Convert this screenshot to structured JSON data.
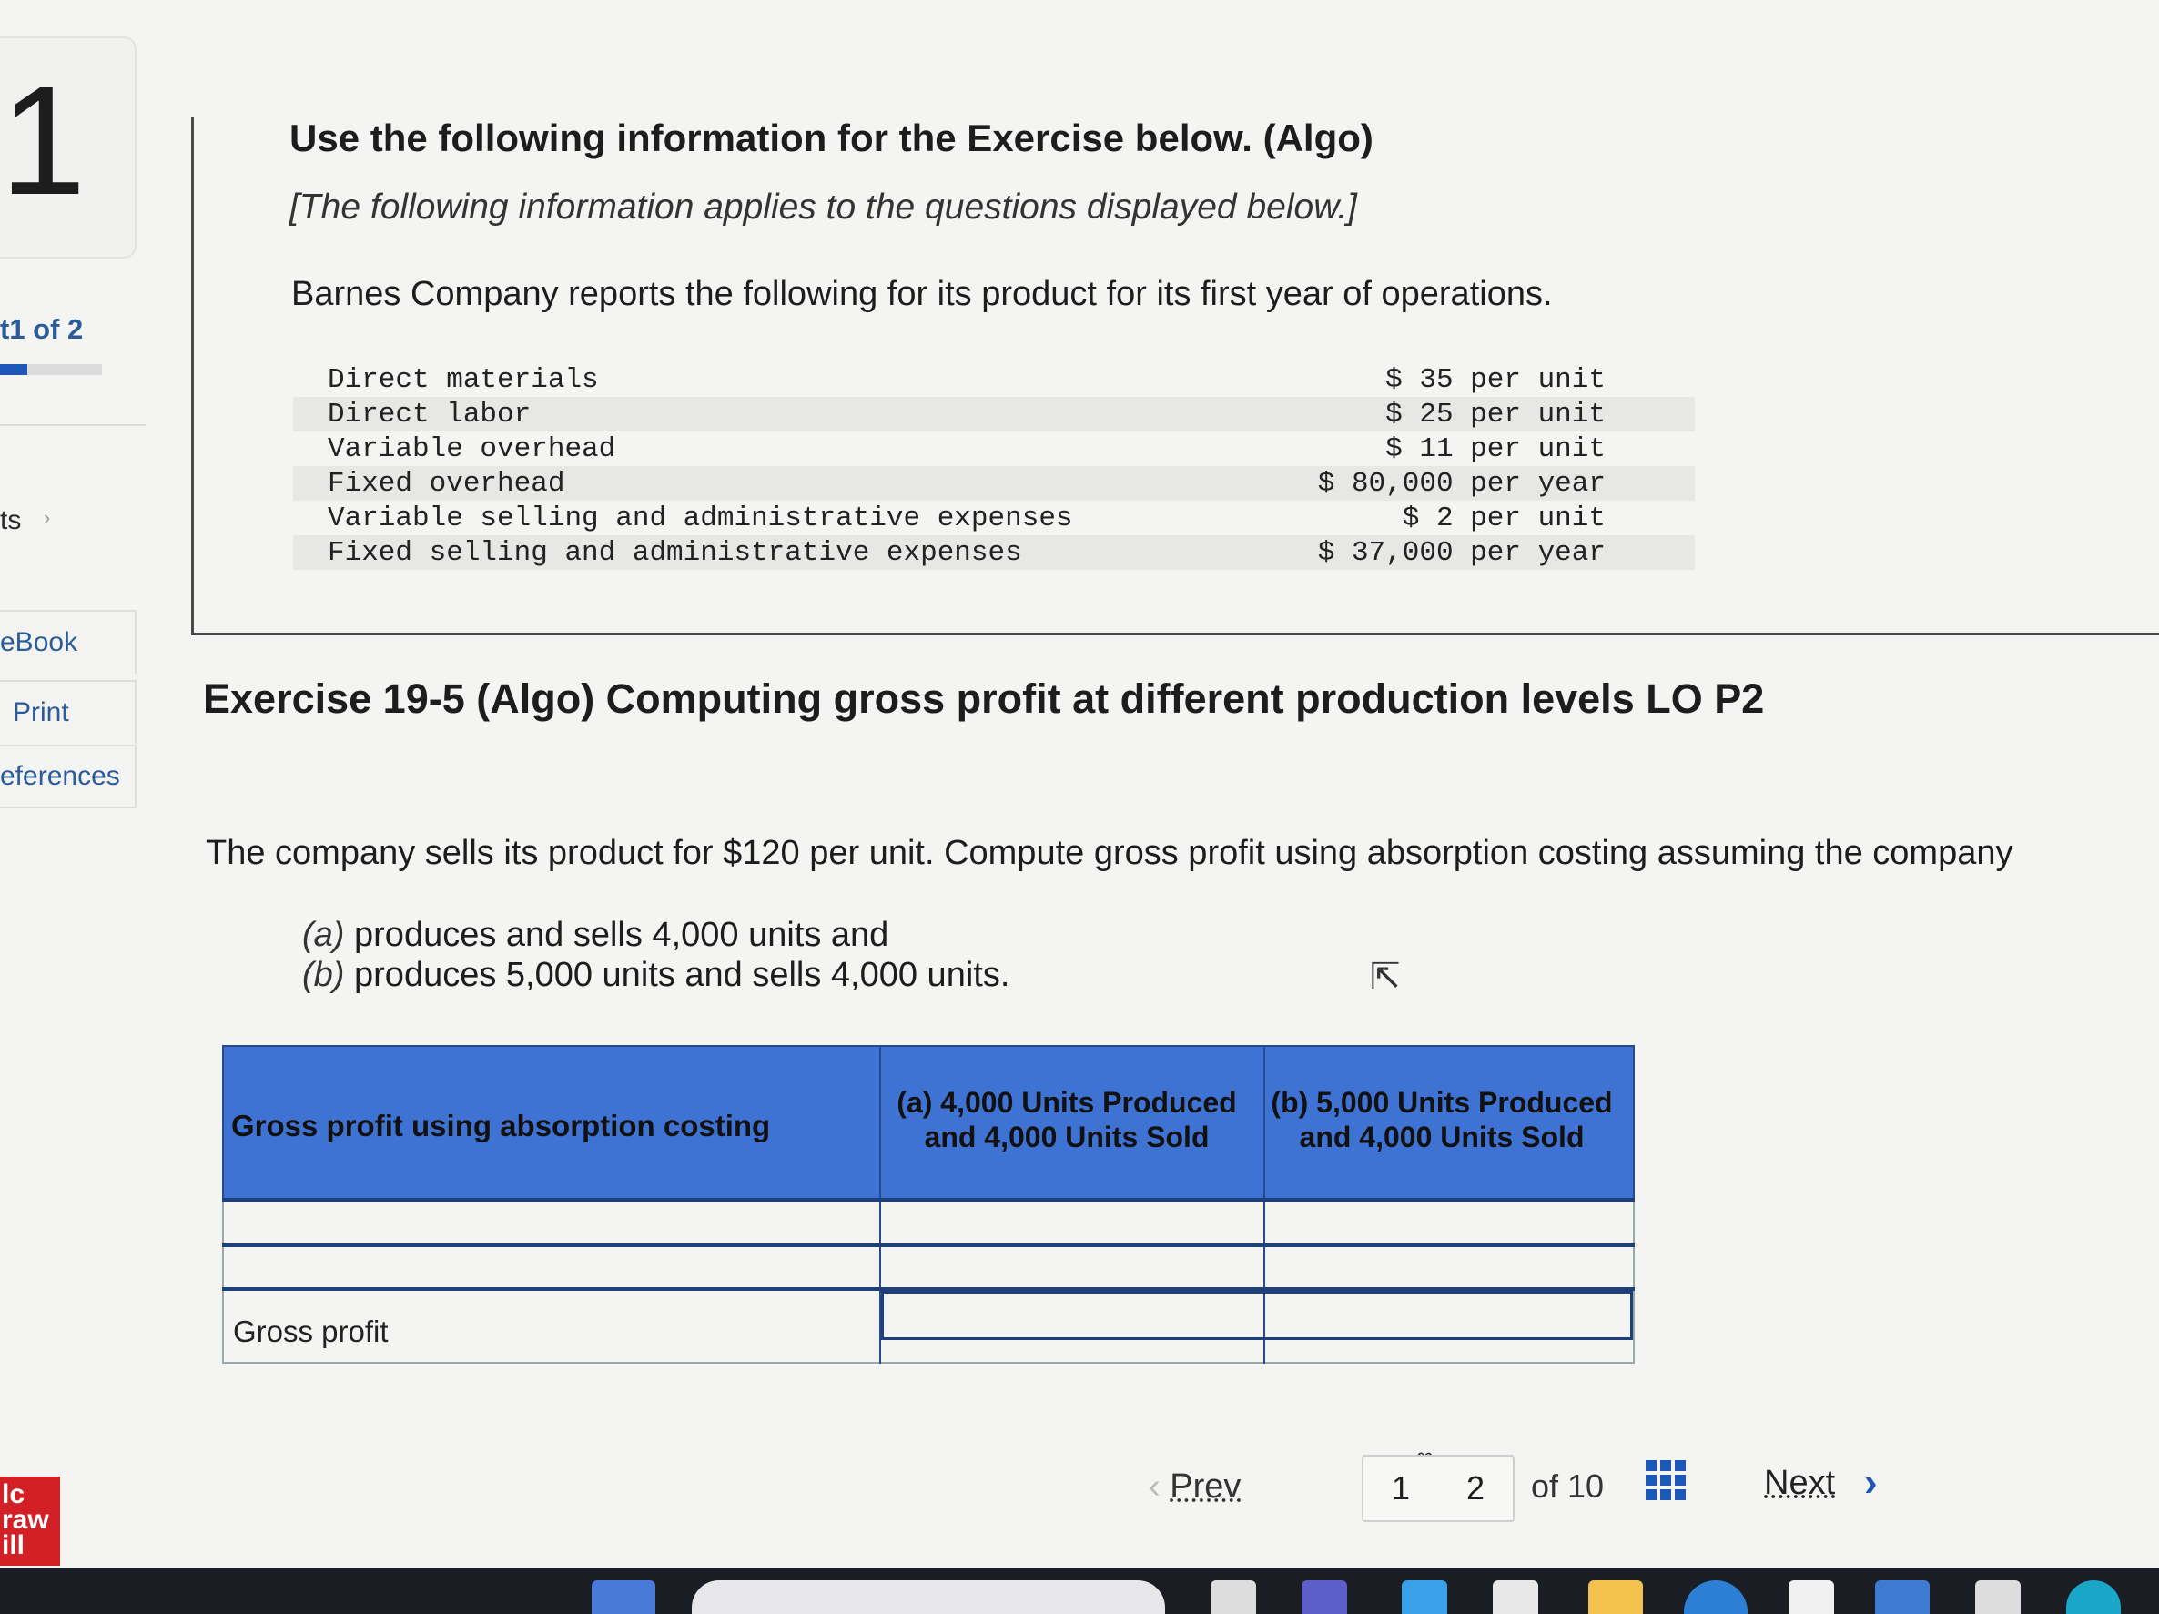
{
  "question_number": "1",
  "part_indicator": {
    "prefix": "t",
    "label": "1 of 2",
    "progress": 0.27
  },
  "sidebar": {
    "truncated_label": "ts",
    "ebook": "eBook",
    "print": "Print",
    "references": "eferences"
  },
  "brand_logo": {
    "lines": [
      "lc",
      "raw",
      "ill"
    ]
  },
  "info": {
    "heading": "Use the following information for the Exercise below. (Algo)",
    "subheading": "[The following information applies to the questions displayed below.]",
    "intro": "Barnes Company reports the following for its product for its first year of operations.",
    "costs": [
      {
        "label": "Direct materials",
        "amount": "$ 35 per unit"
      },
      {
        "label": "Direct labor",
        "amount": "$ 25 per unit"
      },
      {
        "label": "Variable overhead",
        "amount": "$ 11 per unit"
      },
      {
        "label": "Fixed overhead",
        "amount": "$ 80,000 per year"
      },
      {
        "label": "Variable selling and administrative expenses",
        "amount": "$ 2 per unit"
      },
      {
        "label": "Fixed selling and administrative expenses",
        "amount": "$ 37,000 per year"
      }
    ]
  },
  "exercise": {
    "title": "Exercise 19-5 (Algo) Computing gross profit at different production levels LO P2",
    "prompt": "The company sells its product for $120 per unit. Compute gross profit using absorption costing assuming the company",
    "condition_a_tag": "(a)",
    "condition_a": "produces and sells 4,000 units and",
    "condition_b_tag": "(b)",
    "condition_b": "produces 5,000 units and sells 4,000 units."
  },
  "answer_table": {
    "header_label": "Gross profit using absorption costing",
    "col_a_line1": "(a) 4,000 Units Produced",
    "col_a_line2": "and 4,000 Units Sold",
    "col_b_line1": "(b) 5,000 Units Produced",
    "col_b_line2": "and 4,000 Units Sold",
    "total_label": "Gross profit"
  },
  "navigation": {
    "prev": "Prev",
    "pages": [
      "1",
      "2"
    ],
    "of_total": "of 10",
    "next": "Next"
  }
}
